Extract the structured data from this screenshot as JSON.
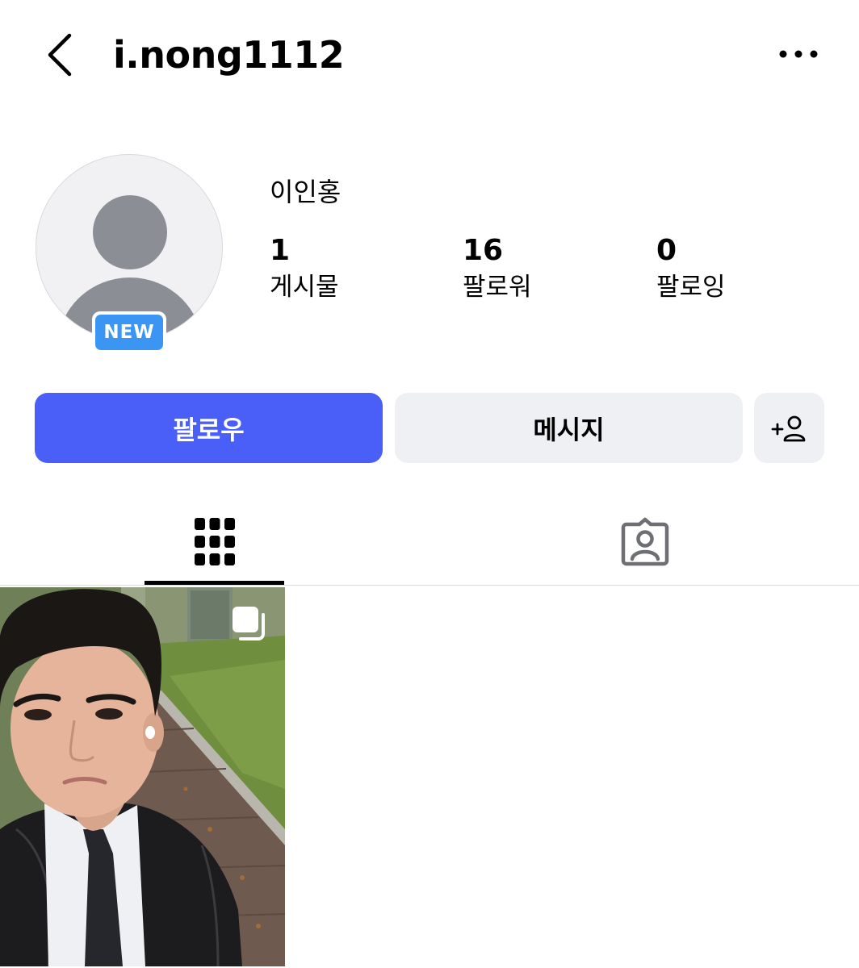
{
  "header": {
    "username": "i.nong1112",
    "back_icon": "chevron-left-icon",
    "more_icon": "more-horizontal-icon"
  },
  "profile": {
    "display_name": "이인홍",
    "new_badge": "NEW",
    "avatar_icon": "default-avatar-icon"
  },
  "stats": {
    "posts": {
      "count": "1",
      "label": "게시물"
    },
    "followers": {
      "count": "16",
      "label": "팔로워"
    },
    "following": {
      "count": "0",
      "label": "팔로잉"
    }
  },
  "actions": {
    "follow_label": "팔로우",
    "message_label": "메시지",
    "suggest_icon": "add-person-icon"
  },
  "tabs": [
    {
      "name": "grid",
      "icon": "grid-icon",
      "active": true
    },
    {
      "name": "tagged",
      "icon": "tagged-person-icon",
      "active": false
    }
  ],
  "posts": [
    {
      "type": "carousel",
      "indicator_icon": "multiple-photos-icon"
    }
  ],
  "colors": {
    "follow_button": "#4a5ef8",
    "secondary_button": "#eff0f3",
    "new_badge": "#3b96f3",
    "avatar_bg": "#f1f1f4",
    "avatar_figure": "#8c8e95"
  }
}
